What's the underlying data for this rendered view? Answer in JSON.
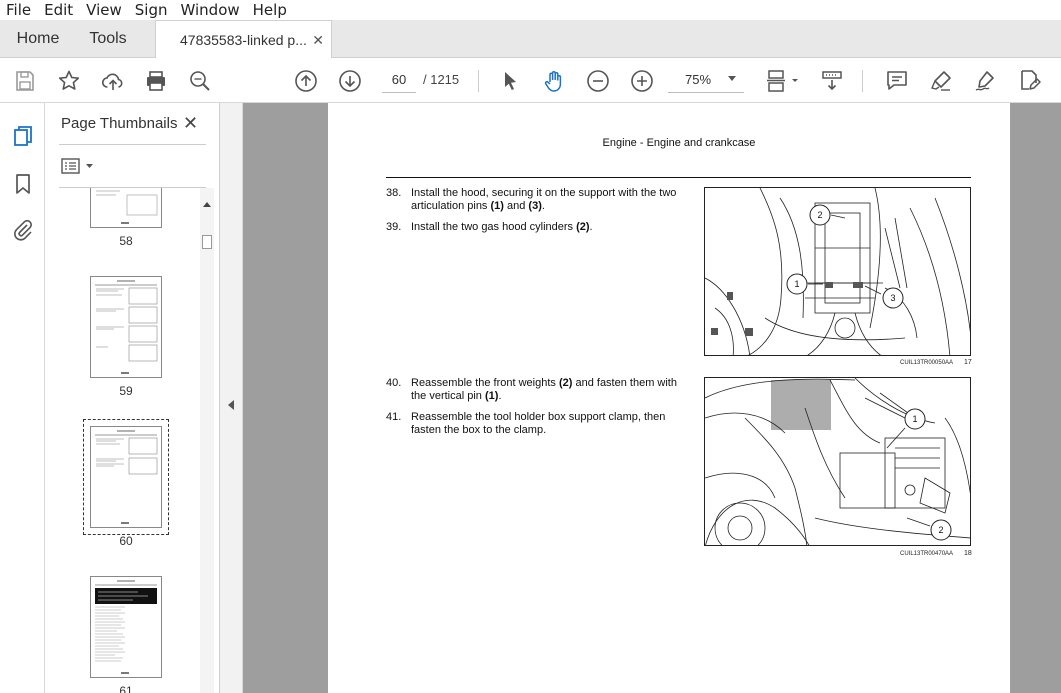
{
  "menu": [
    "File",
    "Edit",
    "View",
    "Sign",
    "Window",
    "Help"
  ],
  "tabs": {
    "home": "Home",
    "tools": "Tools",
    "document": "47835583-linked p...",
    "close": "✕"
  },
  "toolbar": {
    "page_current": "60",
    "page_total": "/ 1215",
    "zoom": "75%"
  },
  "icons": [
    "save-icon",
    "bookmark-star-icon",
    "upload-icon",
    "print-icon",
    "search-zoom-icon",
    "page-up-icon",
    "page-down-icon",
    "pointer-icon",
    "hand-icon",
    "zoom-out-icon",
    "zoom-in-icon",
    "page-fit-icon",
    "scroll-mode-icon",
    "comment-icon",
    "highlight-icon",
    "sign-icon",
    "edit-pdf-icon"
  ],
  "panel": {
    "title": "Page Thumbnails",
    "close": "✕",
    "thumbs": [
      "58",
      "59",
      "60",
      "61"
    ]
  },
  "document": {
    "header": "Engine - Engine and crankcase",
    "steps": [
      {
        "num": "38.",
        "text_html": "Install the hood, securing it on the support with the two articulation pins <b>(1)</b> and <b>(3)</b>."
      },
      {
        "num": "39.",
        "text_html": "Install the two gas hood cylinders <b>(2)</b>."
      },
      {
        "num": "40.",
        "text_html": "Reassemble the front weights <b>(2)</b> and fasten them with the vertical pin <b>(1)</b>."
      },
      {
        "num": "41.",
        "text_html": "Reassemble the tool holder box support clamp, then fasten the box to the clamp."
      }
    ],
    "figures": [
      {
        "caption": "CUIL13TR00050AA",
        "number": "17",
        "callouts": [
          "1",
          "2",
          "3"
        ]
      },
      {
        "caption": "CUIL13TR00470AA",
        "number": "18",
        "callouts": [
          "1",
          "2"
        ]
      }
    ]
  }
}
